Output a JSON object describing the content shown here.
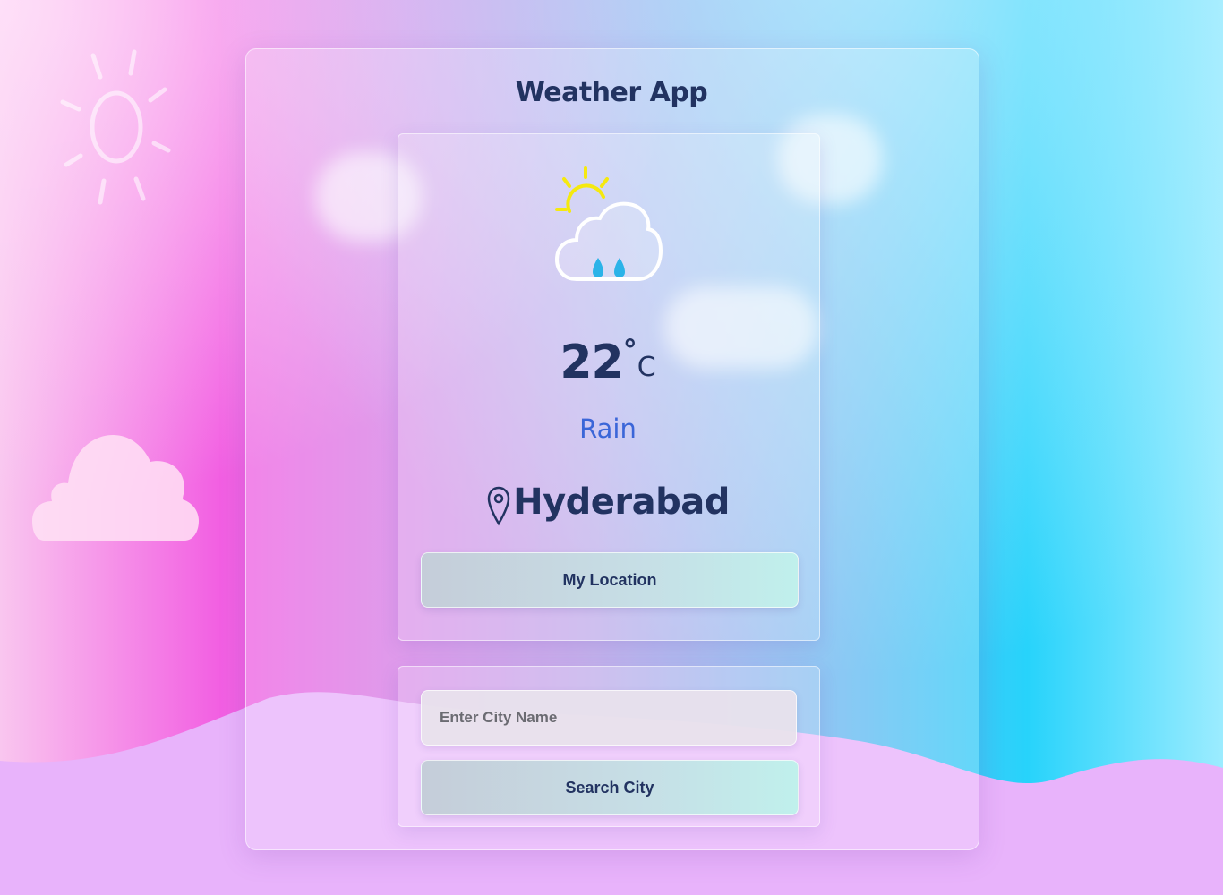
{
  "app": {
    "title": "Weather App"
  },
  "weather": {
    "icon": "sun-cloud-rain-icon",
    "temperature": "22",
    "degree_symbol": "°",
    "unit": "C",
    "condition": "Rain",
    "location_icon": "location-pin-icon",
    "city": "Hyderabad"
  },
  "buttons": {
    "my_location_label": "My Location",
    "search_label": "Search City"
  },
  "search": {
    "placeholder": "Enter City Name",
    "value": ""
  },
  "colors": {
    "text_primary": "#223361",
    "condition_text": "#3b66d8",
    "sun": "#f5e90f",
    "rain_drops": "#2bb3e8"
  },
  "decorations": {
    "background_sun": "sun-outline-icon",
    "background_cloud": "cloud-icon"
  }
}
